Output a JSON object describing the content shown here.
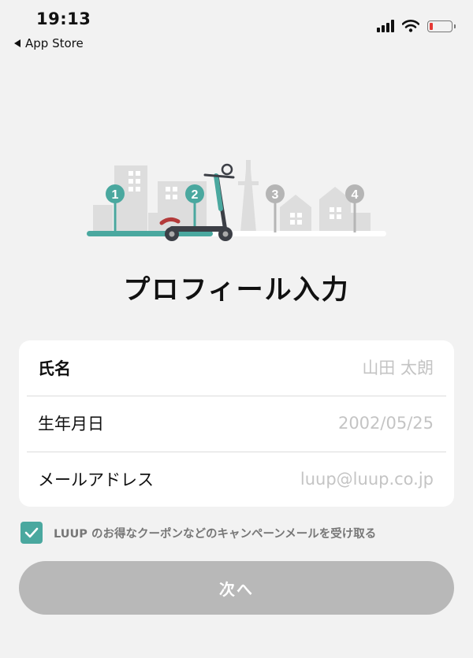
{
  "status_bar": {
    "time": "19:13",
    "back_label": "App Store"
  },
  "colors": {
    "accent": "#4aa89f",
    "button_disabled": "#b8b8b8",
    "background": "#f2f2f2"
  },
  "steps": {
    "s1": "1",
    "s2": "2",
    "s3": "3",
    "s4": "4"
  },
  "title": "プロフィール入力",
  "form": {
    "name": {
      "label": "氏名",
      "placeholder": "山田 太朗"
    },
    "birthdate": {
      "label": "生年月日",
      "placeholder": "2002/05/25"
    },
    "email": {
      "label": "メールアドレス",
      "placeholder": "luup@luup.co.jp"
    }
  },
  "consent": {
    "label": "LUUP のお得なクーポンなどのキャンペーンメールを受け取る",
    "checked": true
  },
  "next_button": {
    "label": "次へ"
  }
}
